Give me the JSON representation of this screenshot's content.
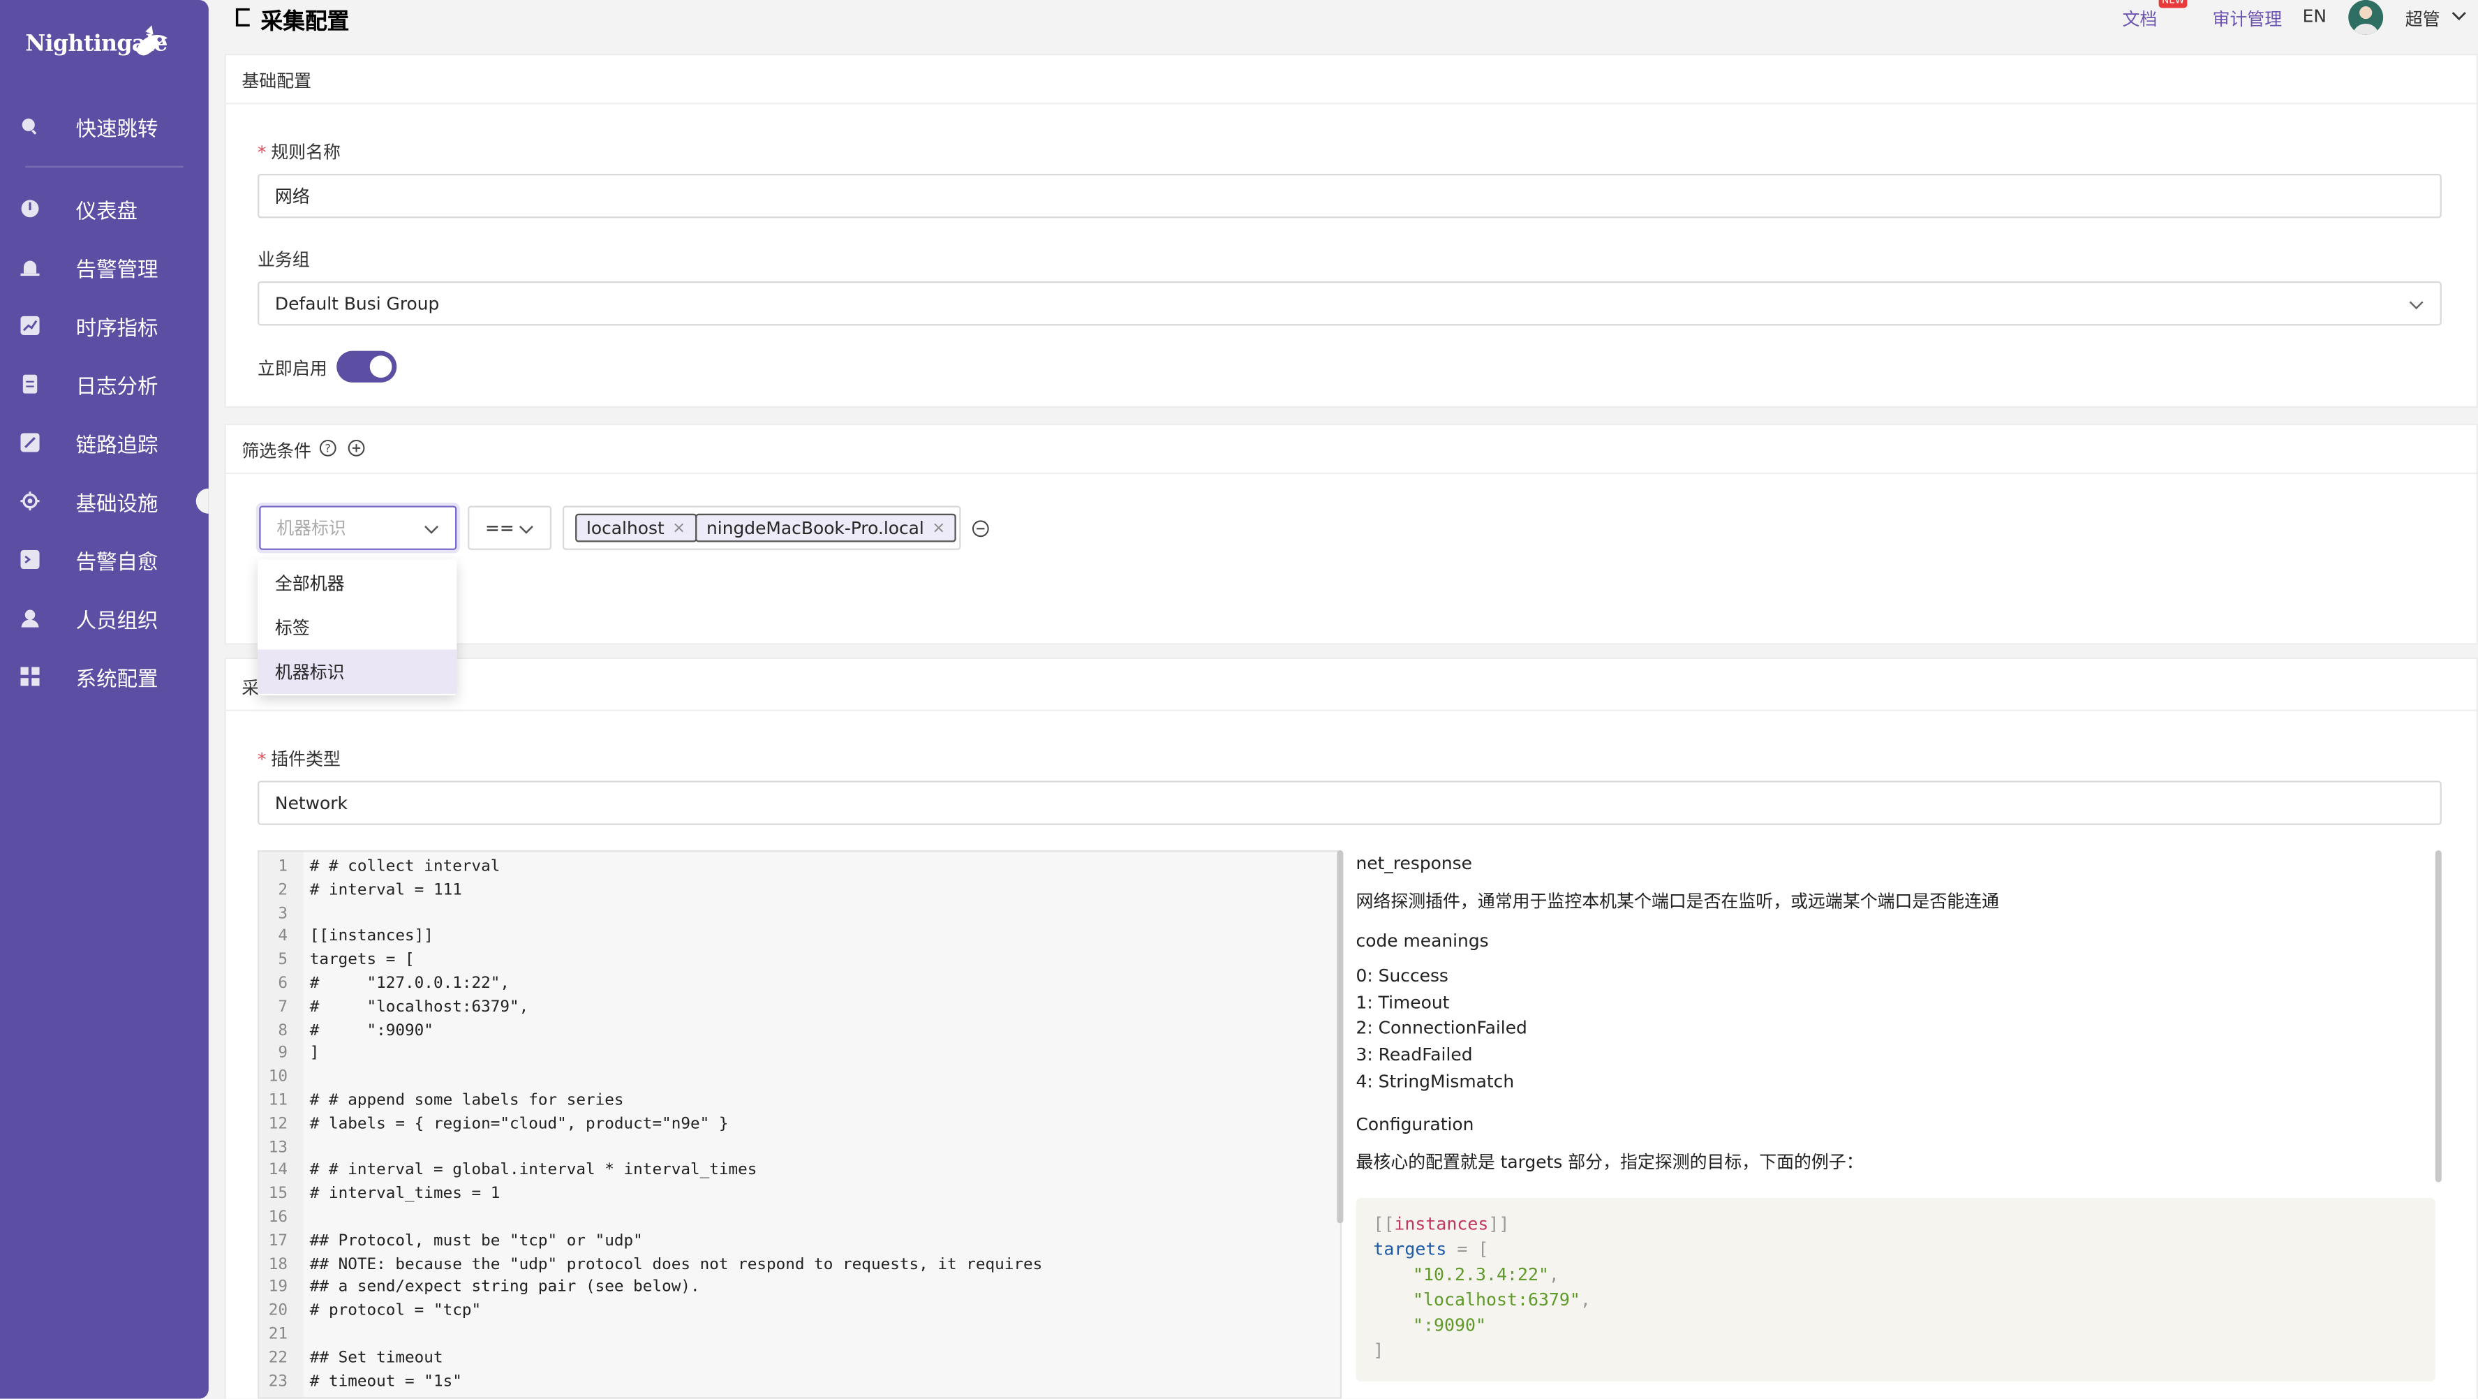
{
  "app": {
    "brand": "Nightingale"
  },
  "sidebar": {
    "items": [
      {
        "label": "快速跳转",
        "icon": "search-icon"
      },
      {
        "label": "仪表盘",
        "icon": "dashboard-icon"
      },
      {
        "label": "告警管理",
        "icon": "alarm-bell-icon"
      },
      {
        "label": "时序指标",
        "icon": "line-chart-icon"
      },
      {
        "label": "日志分析",
        "icon": "document-icon"
      },
      {
        "label": "链路追踪",
        "icon": "trace-icon"
      },
      {
        "label": "基础设施",
        "icon": "infrastructure-icon"
      },
      {
        "label": "告警自愈",
        "icon": "terminal-icon"
      },
      {
        "label": "人员组织",
        "icon": "user-icon"
      },
      {
        "label": "系统配置",
        "icon": "settings-grid-icon"
      }
    ]
  },
  "header": {
    "title": "采集配置",
    "links": {
      "docs": "文档",
      "new_badge": "NEW",
      "audit": "审计管理",
      "lang": "EN",
      "user": "超管"
    }
  },
  "basic": {
    "section_title": "基础配置",
    "rule_name_label": "规则名称",
    "rule_name_value": "网络",
    "busi_group_label": "业务组",
    "busi_group_value": "Default Busi Group",
    "enable_label": "立即启用",
    "enabled": true
  },
  "filter": {
    "section_title": "筛选条件",
    "key_placeholder": "机器标识",
    "operator": "==",
    "tags": [
      "localhost",
      "ningdeMacBook-Pro.local"
    ],
    "dropdown_options": [
      "全部机器",
      "标签",
      "机器标识"
    ],
    "dropdown_selected": "机器标识"
  },
  "collect": {
    "section_title_partial": "采",
    "plugin_type_label": "插件类型",
    "plugin_type_value": "Network",
    "code_lines": [
      "# # collect interval",
      "# interval = 111",
      "",
      "[[instances]]",
      "targets = [",
      "#     \"127.0.0.1:22\",",
      "#     \"localhost:6379\",",
      "#     \":9090\"",
      "]",
      "",
      "# # append some labels for series",
      "# labels = { region=\"cloud\", product=\"n9e\" }",
      "",
      "# # interval = global.interval * interval_times",
      "# interval_times = 1",
      "",
      "## Protocol, must be \"tcp\" or \"udp\"",
      "## NOTE: because the \"udp\" protocol does not respond to requests, it requires",
      "## a send/expect string pair (see below).",
      "# protocol = \"tcp\"",
      "",
      "## Set timeout",
      "# timeout = \"1s\""
    ]
  },
  "doc": {
    "title": "net_response",
    "desc": "网络探测插件，通常用于监控本机某个端口是否在监听，或远端某个端口是否能连通",
    "code_meanings_title": "code meanings",
    "codes": [
      "0: Success",
      "1: Timeout",
      "2: ConnectionFailed",
      "3: ReadFailed",
      "4: StringMismatch"
    ],
    "config_title": "Configuration",
    "config_desc": "最核心的配置就是 targets 部分，指定探测的目标，下面的例子：",
    "example": {
      "open": "[[",
      "section": "instances",
      "close": "]]",
      "key": "targets",
      "eq": " = [",
      "values": [
        "\"10.2.3.4:22\"",
        "\"localhost:6379\"",
        "\":9090\""
      ],
      "end": "]"
    }
  },
  "colors": {
    "sidebar": "#5c4fa3",
    "accent": "#6c53b1",
    "required": "#e34d59"
  }
}
